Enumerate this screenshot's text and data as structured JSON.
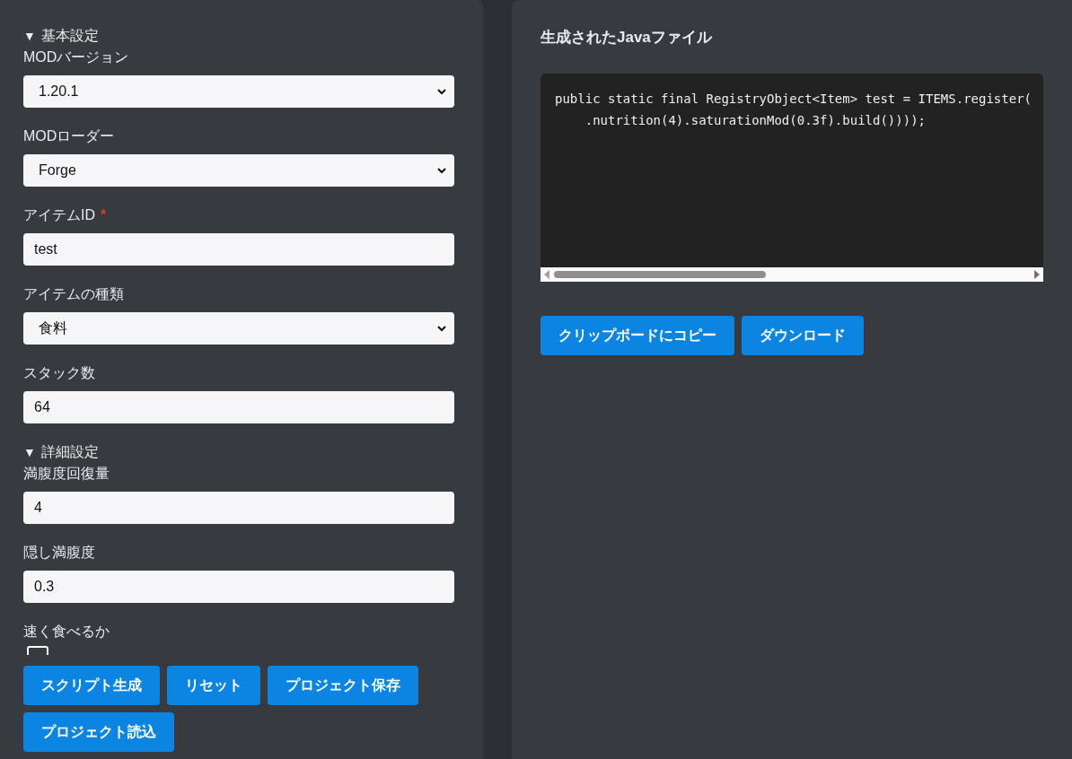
{
  "sections": [
    {
      "marker": "▼",
      "title": "基本設定",
      "expanded": true,
      "fields": [
        {
          "kind": "select",
          "label": "MODバージョン",
          "value": "1.20.1"
        },
        {
          "kind": "select",
          "label": "MODローダー",
          "value": "Forge"
        },
        {
          "kind": "input",
          "label": "アイテムID",
          "required_mark": "*",
          "value": "test"
        },
        {
          "kind": "select",
          "label": "アイテムの種類",
          "value": "食料"
        },
        {
          "kind": "input",
          "label": "スタック数",
          "value": "64"
        }
      ]
    },
    {
      "marker": "▼",
      "title": "詳細設定",
      "expanded": true,
      "fields": [
        {
          "kind": "input",
          "label": "満腹度回復量",
          "value": "4"
        },
        {
          "kind": "input",
          "label": "隠し満腹度",
          "value": "0.3"
        },
        {
          "kind": "checkbox",
          "label": "速く食べるか",
          "checked": false
        }
      ]
    }
  ],
  "form_buttons": [
    "スクリプト生成",
    "リセット",
    "プロジェクト保存",
    "プロジェクト読込"
  ],
  "output": {
    "title": "生成されたJavaファイル",
    "code_lines": [
      "public static final RegistryObject<Item> test = ITEMS.register(",
      "    .nutrition(4).saturationMod(0.3f).build())));"
    ]
  },
  "output_buttons": [
    "クリップボードにコピー",
    "ダウンロード"
  ]
}
